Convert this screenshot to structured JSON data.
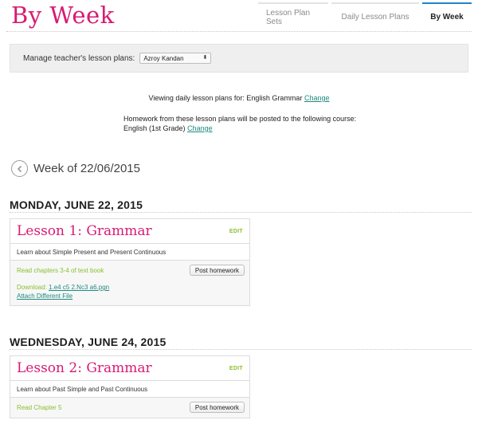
{
  "header": {
    "title": "By Week",
    "tabs": [
      "Lesson Plan Sets",
      "Daily Lesson Plans",
      "By Week"
    ]
  },
  "manage": {
    "label": "Manage teacher's lesson plans:",
    "selected_teacher": "Azroy Kandan",
    "arrows": "⬍"
  },
  "viewing": {
    "text": "Viewing daily lesson plans for: English Grammar",
    "change": "Change"
  },
  "homework_info": {
    "line1": "Homework from these lesson plans will be posted to the following course:",
    "course": "English (1st Grade)",
    "change": "Change"
  },
  "week": {
    "label": "Week of 22/06/2015"
  },
  "days": [
    {
      "heading": "MONDAY, JUNE 22, 2015",
      "lesson": {
        "title": "Lesson 1: Grammar",
        "edit": "EDIT",
        "description": "Learn about Simple Present and Present Continuous",
        "homework": "Read chapters 3-4 of text book",
        "post_button": "Post homework",
        "download_label": "Download:",
        "download_file": "1.e4 c5 2.Nc3 a6.pgn",
        "attach": "Attach Different File"
      }
    },
    {
      "heading": "WEDNESDAY, JUNE 24, 2015",
      "lesson": {
        "title": "Lesson 2: Grammar",
        "edit": "EDIT",
        "description": "Learn about Past Simple and Past Continuous",
        "homework": "Read Chapter 5",
        "post_button": "Post homework"
      }
    }
  ],
  "colors": {
    "title_pink": "#d81b72",
    "accent_green": "#8bbf2e",
    "link_teal": "#1f8a7f",
    "active_tab_blue": "#1f86c6"
  }
}
